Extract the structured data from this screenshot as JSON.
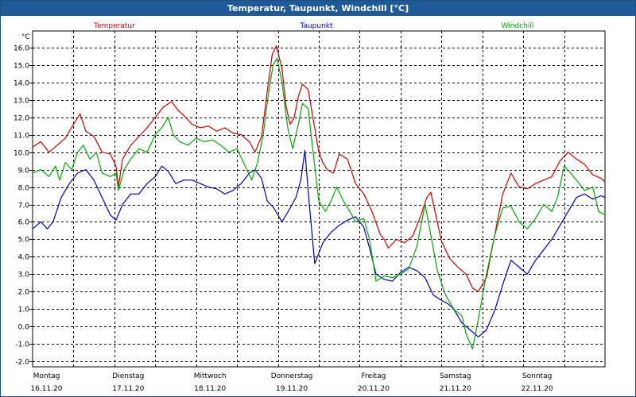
{
  "window": {
    "title": "Temperatur, Taupunkt, Windchill [°C]"
  },
  "chart_data": {
    "type": "line",
    "title": "Temperatur, Taupunkt, Windchill [°C]",
    "ylabel": "°C",
    "ylim": [
      -2.0,
      16.0
    ],
    "y_ticks": [
      "-2.0",
      "-1.0",
      "0.0",
      "1.0",
      "2.0",
      "3.0",
      "4.0",
      "5.0",
      "6.0",
      "7.0",
      "8.0",
      "9.0",
      "10.0",
      "11.0",
      "12.0",
      "13.0",
      "14.0",
      "15.0",
      "16.0"
    ],
    "xlim": [
      0,
      7
    ],
    "day_labels": [
      {
        "weekday": "Montag",
        "date": "16.11.20"
      },
      {
        "weekday": "Dienstag",
        "date": "17.11.20"
      },
      {
        "weekday": "Mittwoch",
        "date": "18.11.20"
      },
      {
        "weekday": "Donnerstag",
        "date": "19.11.20"
      },
      {
        "weekday": "Freitag",
        "date": "20.11.20"
      },
      {
        "weekday": "Samstag",
        "date": "21.11.20"
      },
      {
        "weekday": "Sonntag",
        "date": "22.11.20"
      }
    ],
    "grid": true,
    "legend_position": "top",
    "series": [
      {
        "name": "Temperatur",
        "color": "#cc0000",
        "points": [
          [
            0.0,
            10.3
          ],
          [
            0.1,
            10.6
          ],
          [
            0.2,
            10.0
          ],
          [
            0.3,
            10.4
          ],
          [
            0.4,
            10.8
          ],
          [
            0.5,
            11.6
          ],
          [
            0.58,
            12.2
          ],
          [
            0.65,
            11.2
          ],
          [
            0.75,
            10.9
          ],
          [
            0.85,
            10.0
          ],
          [
            0.95,
            9.9
          ],
          [
            1.02,
            9.2
          ],
          [
            1.05,
            8.0
          ],
          [
            1.1,
            9.6
          ],
          [
            1.2,
            10.4
          ],
          [
            1.3,
            10.9
          ],
          [
            1.4,
            11.4
          ],
          [
            1.5,
            12.0
          ],
          [
            1.6,
            12.6
          ],
          [
            1.7,
            12.9
          ],
          [
            1.78,
            12.4
          ],
          [
            1.85,
            12.1
          ],
          [
            1.95,
            11.6
          ],
          [
            2.05,
            11.4
          ],
          [
            2.15,
            11.5
          ],
          [
            2.25,
            11.2
          ],
          [
            2.35,
            11.4
          ],
          [
            2.45,
            11.1
          ],
          [
            2.55,
            11.0
          ],
          [
            2.65,
            10.6
          ],
          [
            2.72,
            10.0
          ],
          [
            2.8,
            10.9
          ],
          [
            2.87,
            13.5
          ],
          [
            2.93,
            15.6
          ],
          [
            2.98,
            16.1
          ],
          [
            3.05,
            14.8
          ],
          [
            3.1,
            12.6
          ],
          [
            3.15,
            11.6
          ],
          [
            3.2,
            12.0
          ],
          [
            3.25,
            13.2
          ],
          [
            3.3,
            13.9
          ],
          [
            3.37,
            13.6
          ],
          [
            3.42,
            12.2
          ],
          [
            3.5,
            10.0
          ],
          [
            3.55,
            9.4
          ],
          [
            3.6,
            9.0
          ],
          [
            3.68,
            8.8
          ],
          [
            3.75,
            9.9
          ],
          [
            3.85,
            9.6
          ],
          [
            3.95,
            8.2
          ],
          [
            4.05,
            7.6
          ],
          [
            4.15,
            6.6
          ],
          [
            4.25,
            5.3
          ],
          [
            4.3,
            5.0
          ],
          [
            4.35,
            4.5
          ],
          [
            4.45,
            5.0
          ],
          [
            4.55,
            4.8
          ],
          [
            4.65,
            5.2
          ],
          [
            4.75,
            6.4
          ],
          [
            4.82,
            7.4
          ],
          [
            4.87,
            7.7
          ],
          [
            4.92,
            6.6
          ],
          [
            5.0,
            4.9
          ],
          [
            5.1,
            3.9
          ],
          [
            5.2,
            3.4
          ],
          [
            5.3,
            3.0
          ],
          [
            5.38,
            2.2
          ],
          [
            5.45,
            2.0
          ],
          [
            5.55,
            2.8
          ],
          [
            5.65,
            5.2
          ],
          [
            5.75,
            7.6
          ],
          [
            5.85,
            8.8
          ],
          [
            5.95,
            8.0
          ],
          [
            6.05,
            7.9
          ],
          [
            6.15,
            8.2
          ],
          [
            6.25,
            8.4
          ],
          [
            6.35,
            8.6
          ],
          [
            6.45,
            9.5
          ],
          [
            6.55,
            10.0
          ],
          [
            6.65,
            9.6
          ],
          [
            6.75,
            9.3
          ],
          [
            6.85,
            8.7
          ],
          [
            6.95,
            8.5
          ],
          [
            7.0,
            8.3
          ]
        ]
      },
      {
        "name": "Taupunkt",
        "color": "#0000bb",
        "points": [
          [
            0.0,
            5.6
          ],
          [
            0.1,
            6.0
          ],
          [
            0.18,
            5.6
          ],
          [
            0.25,
            6.0
          ],
          [
            0.35,
            7.4
          ],
          [
            0.45,
            8.2
          ],
          [
            0.55,
            8.8
          ],
          [
            0.65,
            9.0
          ],
          [
            0.75,
            8.4
          ],
          [
            0.85,
            7.4
          ],
          [
            0.95,
            6.4
          ],
          [
            1.02,
            6.1
          ],
          [
            1.1,
            7.0
          ],
          [
            1.2,
            7.6
          ],
          [
            1.3,
            7.6
          ],
          [
            1.4,
            8.2
          ],
          [
            1.5,
            8.6
          ],
          [
            1.58,
            9.2
          ],
          [
            1.66,
            8.9
          ],
          [
            1.75,
            8.2
          ],
          [
            1.85,
            8.4
          ],
          [
            1.95,
            8.4
          ],
          [
            2.05,
            8.2
          ],
          [
            2.15,
            8.0
          ],
          [
            2.25,
            7.9
          ],
          [
            2.35,
            7.6
          ],
          [
            2.45,
            7.8
          ],
          [
            2.55,
            8.2
          ],
          [
            2.65,
            8.8
          ],
          [
            2.72,
            9.0
          ],
          [
            2.8,
            8.5
          ],
          [
            2.87,
            7.2
          ],
          [
            2.95,
            6.8
          ],
          [
            3.05,
            6.0
          ],
          [
            3.15,
            6.8
          ],
          [
            3.22,
            7.4
          ],
          [
            3.28,
            8.4
          ],
          [
            3.33,
            10.1
          ],
          [
            3.38,
            7.2
          ],
          [
            3.45,
            3.6
          ],
          [
            3.55,
            4.8
          ],
          [
            3.65,
            5.4
          ],
          [
            3.75,
            5.8
          ],
          [
            3.85,
            6.1
          ],
          [
            3.95,
            6.3
          ],
          [
            4.05,
            5.7
          ],
          [
            4.12,
            4.5
          ],
          [
            4.2,
            3.0
          ],
          [
            4.3,
            2.7
          ],
          [
            4.4,
            2.6
          ],
          [
            4.5,
            3.1
          ],
          [
            4.6,
            3.4
          ],
          [
            4.7,
            3.2
          ],
          [
            4.8,
            2.8
          ],
          [
            4.9,
            1.8
          ],
          [
            5.0,
            1.5
          ],
          [
            5.08,
            1.3
          ],
          [
            5.15,
            1.0
          ],
          [
            5.25,
            0.2
          ],
          [
            5.35,
            -0.2
          ],
          [
            5.45,
            -0.6
          ],
          [
            5.55,
            -0.2
          ],
          [
            5.65,
            0.9
          ],
          [
            5.75,
            2.4
          ],
          [
            5.85,
            3.8
          ],
          [
            5.95,
            3.4
          ],
          [
            6.05,
            3.0
          ],
          [
            6.15,
            3.8
          ],
          [
            6.25,
            4.4
          ],
          [
            6.35,
            5.0
          ],
          [
            6.45,
            5.8
          ],
          [
            6.55,
            6.6
          ],
          [
            6.65,
            7.4
          ],
          [
            6.75,
            7.6
          ],
          [
            6.85,
            7.3
          ],
          [
            6.95,
            7.5
          ],
          [
            7.0,
            7.4
          ]
        ]
      },
      {
        "name": "Windchill",
        "color": "#00aa00",
        "points": [
          [
            0.0,
            8.8
          ],
          [
            0.1,
            9.0
          ],
          [
            0.2,
            8.6
          ],
          [
            0.28,
            9.2
          ],
          [
            0.33,
            8.4
          ],
          [
            0.4,
            9.4
          ],
          [
            0.48,
            9.0
          ],
          [
            0.55,
            10.0
          ],
          [
            0.62,
            10.4
          ],
          [
            0.7,
            9.6
          ],
          [
            0.78,
            10.0
          ],
          [
            0.85,
            8.8
          ],
          [
            0.95,
            8.6
          ],
          [
            1.02,
            8.8
          ],
          [
            1.05,
            7.8
          ],
          [
            1.12,
            9.0
          ],
          [
            1.2,
            9.6
          ],
          [
            1.3,
            10.2
          ],
          [
            1.4,
            10.0
          ],
          [
            1.5,
            11.0
          ],
          [
            1.58,
            11.4
          ],
          [
            1.66,
            12.0
          ],
          [
            1.72,
            11.0
          ],
          [
            1.8,
            10.6
          ],
          [
            1.9,
            10.4
          ],
          [
            2.0,
            10.8
          ],
          [
            2.1,
            10.6
          ],
          [
            2.2,
            10.7
          ],
          [
            2.3,
            10.4
          ],
          [
            2.4,
            10.0
          ],
          [
            2.5,
            10.2
          ],
          [
            2.6,
            9.2
          ],
          [
            2.68,
            8.4
          ],
          [
            2.75,
            9.4
          ],
          [
            2.82,
            11.0
          ],
          [
            2.88,
            13.2
          ],
          [
            2.94,
            15.0
          ],
          [
            2.99,
            15.4
          ],
          [
            3.05,
            14.0
          ],
          [
            3.12,
            11.4
          ],
          [
            3.18,
            10.2
          ],
          [
            3.25,
            11.6
          ],
          [
            3.3,
            12.8
          ],
          [
            3.37,
            12.5
          ],
          [
            3.42,
            10.4
          ],
          [
            3.5,
            7.2
          ],
          [
            3.58,
            6.6
          ],
          [
            3.65,
            7.2
          ],
          [
            3.72,
            8.0
          ],
          [
            3.8,
            7.2
          ],
          [
            3.88,
            6.6
          ],
          [
            3.95,
            6.0
          ],
          [
            4.05,
            6.2
          ],
          [
            4.12,
            5.0
          ],
          [
            4.2,
            2.6
          ],
          [
            4.3,
            2.9
          ],
          [
            4.4,
            2.8
          ],
          [
            4.5,
            3.0
          ],
          [
            4.6,
            3.3
          ],
          [
            4.7,
            4.6
          ],
          [
            4.8,
            7.0
          ],
          [
            4.88,
            5.0
          ],
          [
            4.95,
            3.2
          ],
          [
            5.05,
            1.8
          ],
          [
            5.15,
            1.0
          ],
          [
            5.25,
            0.6
          ],
          [
            5.3,
            -0.4
          ],
          [
            5.38,
            -1.3
          ],
          [
            5.45,
            0.4
          ],
          [
            5.55,
            3.0
          ],
          [
            5.65,
            5.2
          ],
          [
            5.75,
            6.8
          ],
          [
            5.85,
            6.9
          ],
          [
            5.95,
            6.0
          ],
          [
            6.05,
            5.6
          ],
          [
            6.15,
            6.2
          ],
          [
            6.25,
            7.0
          ],
          [
            6.35,
            6.6
          ],
          [
            6.42,
            7.4
          ],
          [
            6.5,
            9.2
          ],
          [
            6.58,
            8.8
          ],
          [
            6.65,
            8.4
          ],
          [
            6.75,
            7.8
          ],
          [
            6.85,
            8.0
          ],
          [
            6.92,
            6.6
          ],
          [
            7.0,
            6.4
          ]
        ]
      }
    ]
  }
}
